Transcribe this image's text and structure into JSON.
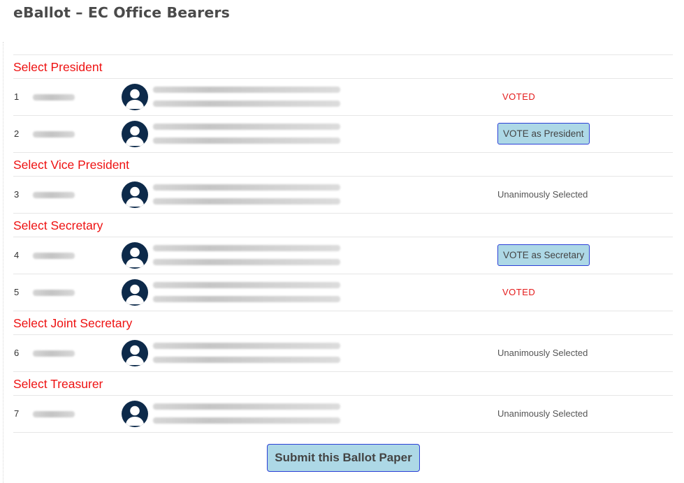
{
  "page": {
    "title": "eBallot – EC Office Bearers"
  },
  "colors": {
    "section_header": "#ee1111",
    "voted": "#e41b1b",
    "button_bg": "#add8e6",
    "button_border": "#2b3fd6",
    "avatar": "#0d2a4a"
  },
  "sections": [
    {
      "label": "Select President",
      "candidates": [
        {
          "serial": "1",
          "status": "voted",
          "status_text": "VOTED"
        },
        {
          "serial": "2",
          "status": "button",
          "status_text": "VOTE as President"
        }
      ]
    },
    {
      "label": "Select Vice President",
      "candidates": [
        {
          "serial": "3",
          "status": "unanimous",
          "status_text": "Unanimously Selected"
        }
      ]
    },
    {
      "label": "Select Secretary",
      "candidates": [
        {
          "serial": "4",
          "status": "button",
          "status_text": "VOTE as Secretary"
        },
        {
          "serial": "5",
          "status": "voted",
          "status_text": "VOTED"
        }
      ]
    },
    {
      "label": "Select Joint Secretary",
      "candidates": [
        {
          "serial": "6",
          "status": "unanimous",
          "status_text": "Unanimously Selected"
        }
      ]
    },
    {
      "label": "Select Treasurer",
      "candidates": [
        {
          "serial": "7",
          "status": "unanimous",
          "status_text": "Unanimously Selected"
        }
      ]
    }
  ],
  "submit": {
    "label": "Submit this Ballot Paper"
  },
  "icons": {
    "avatar": "user-avatar-icon"
  }
}
